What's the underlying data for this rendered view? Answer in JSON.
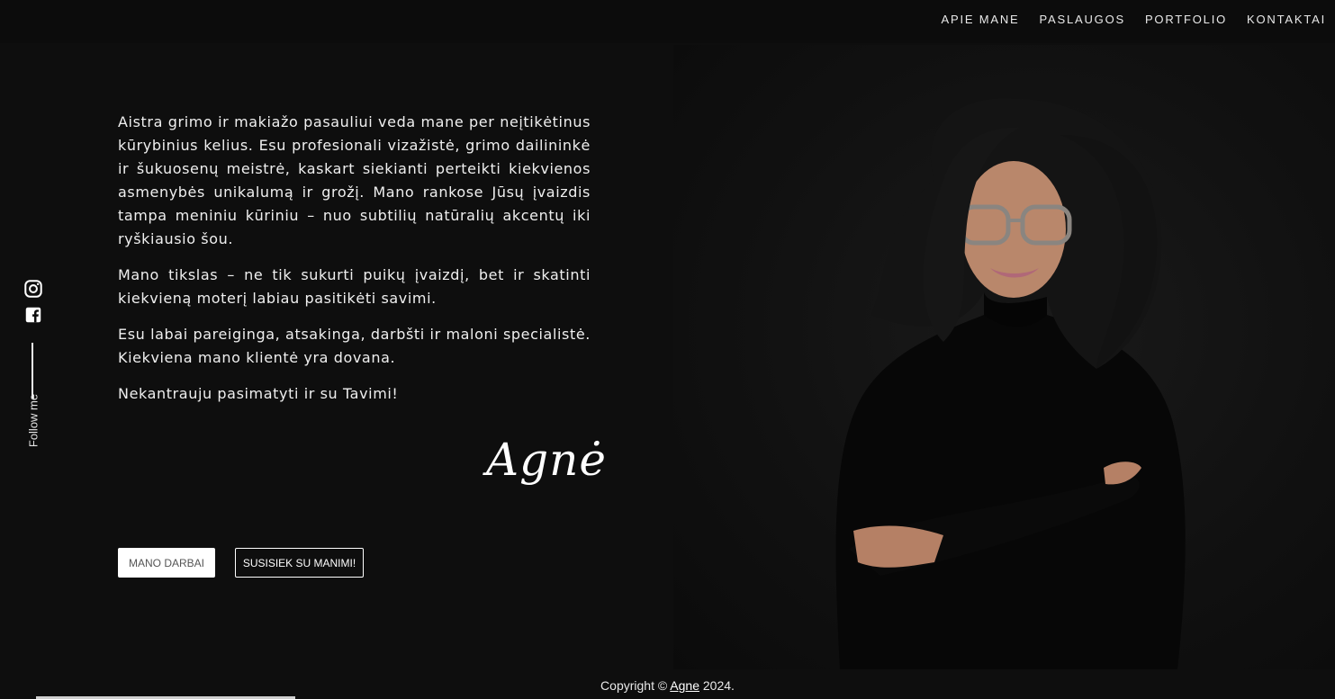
{
  "nav": {
    "items": [
      "APIE MANE",
      "PASLAUGOS",
      "PORTFOLIO",
      "KONTAKTAI"
    ]
  },
  "social": {
    "instagram_icon": "instagram-icon",
    "facebook_icon": "facebook-icon",
    "follow_label": "Follow me"
  },
  "about": {
    "paragraphs": [
      "Aistra grimo ir makiažo pasauliui veda mane per neįtikėtinus kūrybinius kelius. Esu profesionali vizažistė, grimo dailininkė ir šukuosenų meistrė, kaskart siekianti perteikti kiekvienos asmenybės unikalumą ir grožį. Mano rankose Jūsų įvaizdis tampa meniniu kūriniu – nuo subtilių natūralių akcentų iki ryškiausio šou.",
      "Mano tikslas – ne tik sukurti puikų įvaizdį, bet ir skatinti kiekvieną moterį labiau pasitikėti savimi.",
      "Esu labai pareiginga, atsakinga, darbšti ir maloni specialistė. Kiekviena mano klientė yra dovana.",
      "Nekantrauju pasimatyti ir su Tavimi!"
    ],
    "signature": "Agnė"
  },
  "buttons": {
    "works": "MANO DARBAI",
    "contact": "SUSISIEK SU MANIMI!"
  },
  "footer": {
    "prefix": "Copyright © ",
    "link": "Agne",
    "suffix": " 2024."
  },
  "colors": {
    "background": "#0e0e0e",
    "text": "#efefef",
    "accent": "#ffffff"
  }
}
